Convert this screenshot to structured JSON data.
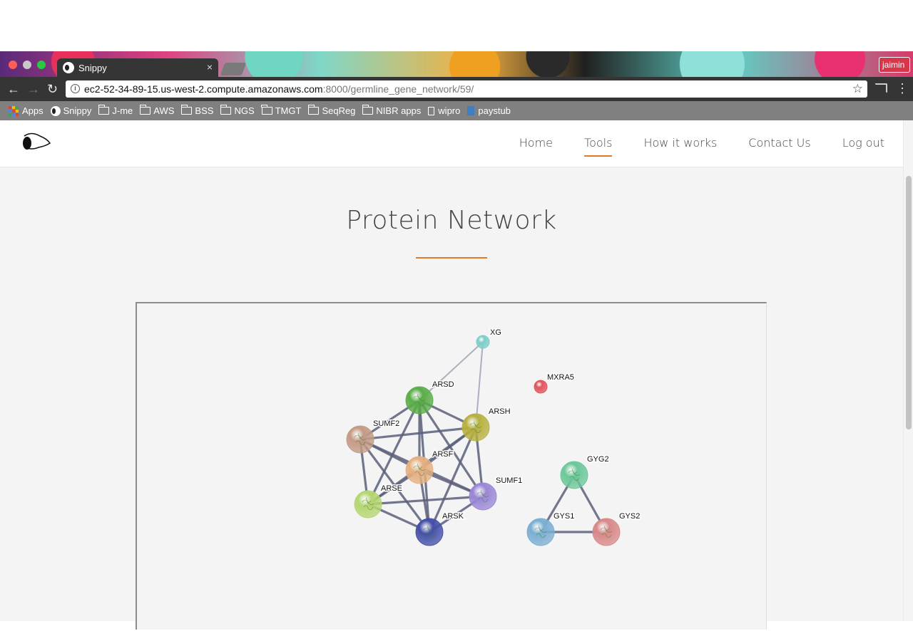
{
  "browser": {
    "tab_title": "Snippy",
    "tab_close": "×",
    "profile_name": "jaimin",
    "url_host": "ec2-52-34-89-15.us-west-2.compute.amazonaws.com",
    "url_path": ":8000/germline_gene_network/59/",
    "bookmarks": [
      "Apps",
      "Snippy",
      "J-me",
      "AWS",
      "BSS",
      "NGS",
      "TMGT",
      "SeqReg",
      "NIBR apps",
      "wipro",
      "paystub"
    ]
  },
  "nav": {
    "home": "Home",
    "tools": "Tools",
    "how": "How it works",
    "contact": "Contact Us",
    "logout": "Log out",
    "active_color": "#e07b2a"
  },
  "page": {
    "title": "Protein Network"
  },
  "network": {
    "nodes": [
      {
        "id": "XG",
        "color": "#7ecdc8"
      },
      {
        "id": "MXRA5",
        "color": "#e0545e"
      },
      {
        "id": "ARSD",
        "color": "#5aad48"
      },
      {
        "id": "ARSH",
        "color": "#b7b040"
      },
      {
        "id": "SUMF2",
        "color": "#c49a86"
      },
      {
        "id": "ARSF",
        "color": "#e5b080"
      },
      {
        "id": "SUMF1",
        "color": "#9a86d6"
      },
      {
        "id": "ARSE",
        "color": "#b4d672"
      },
      {
        "id": "ARSK",
        "color": "#4450a8"
      },
      {
        "id": "GYG2",
        "color": "#6cc79a"
      },
      {
        "id": "GYS1",
        "color": "#7aaed2"
      },
      {
        "id": "GYS2",
        "color": "#d88888"
      }
    ],
    "edges": [
      [
        "XG",
        "ARSD"
      ],
      [
        "XG",
        "ARSH"
      ],
      [
        "ARSD",
        "ARSH"
      ],
      [
        "ARSD",
        "SUMF2"
      ],
      [
        "ARSD",
        "ARSF"
      ],
      [
        "ARSD",
        "SUMF1"
      ],
      [
        "ARSD",
        "ARSE"
      ],
      [
        "ARSD",
        "ARSK"
      ],
      [
        "ARSH",
        "SUMF2"
      ],
      [
        "ARSH",
        "ARSF"
      ],
      [
        "ARSH",
        "SUMF1"
      ],
      [
        "ARSH",
        "ARSE"
      ],
      [
        "ARSH",
        "ARSK"
      ],
      [
        "SUMF2",
        "ARSF"
      ],
      [
        "SUMF2",
        "SUMF1"
      ],
      [
        "SUMF2",
        "ARSE"
      ],
      [
        "SUMF2",
        "ARSK"
      ],
      [
        "ARSF",
        "SUMF1"
      ],
      [
        "ARSF",
        "ARSE"
      ],
      [
        "ARSF",
        "ARSK"
      ],
      [
        "SUMF1",
        "ARSE"
      ],
      [
        "SUMF1",
        "ARSK"
      ],
      [
        "ARSE",
        "ARSK"
      ],
      [
        "GYG2",
        "GYS1"
      ],
      [
        "GYG2",
        "GYS2"
      ],
      [
        "GYS1",
        "GYS2"
      ]
    ]
  }
}
